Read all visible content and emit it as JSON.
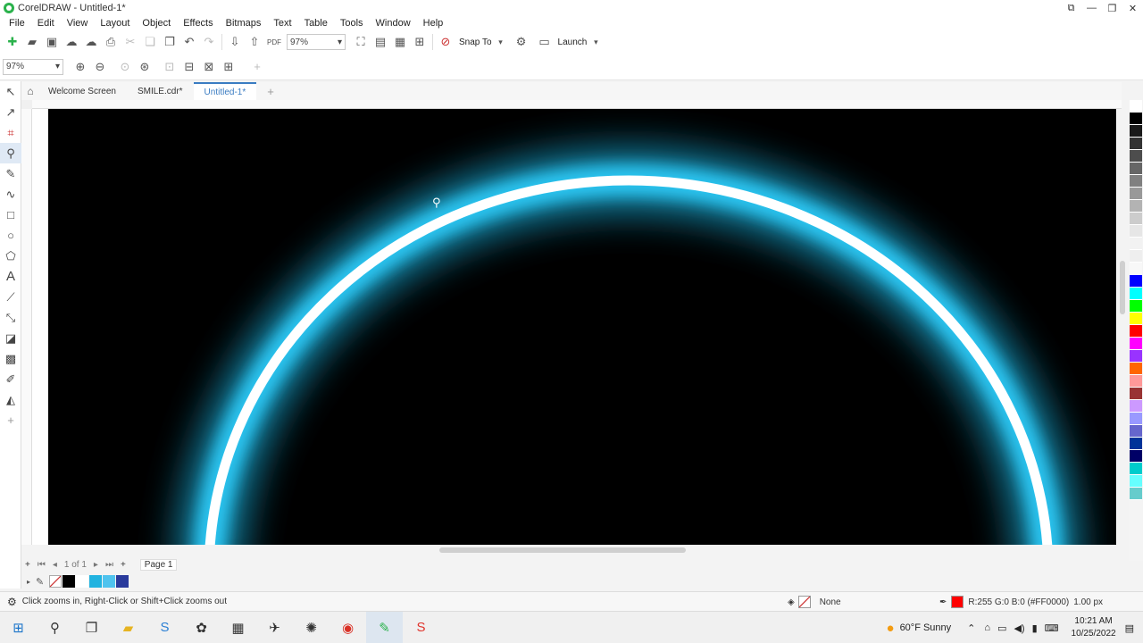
{
  "window": {
    "title": "CorelDRAW - Untitled-1*"
  },
  "menu": [
    "File",
    "Edit",
    "View",
    "Layout",
    "Object",
    "Effects",
    "Bitmaps",
    "Text",
    "Table",
    "Tools",
    "Window",
    "Help"
  ],
  "toolbar": {
    "zoom_value": "97%",
    "snap_to_label": "Snap To",
    "launch_label": "Launch"
  },
  "zoombar": {
    "zoom_value": "97%"
  },
  "tabs": [
    {
      "label": "Welcome Screen",
      "active": false
    },
    {
      "label": "SMILE.cdr*",
      "active": false
    },
    {
      "label": "Untitled-1*",
      "active": true
    }
  ],
  "pages": {
    "counter": "1 of 1",
    "page_tab": "Page 1"
  },
  "status": {
    "hint": "Click zooms in, Right-Click or Shift+Click zooms out",
    "fill_label": "None",
    "outline_color_text": "R:255 G:0 B:0 (#FF0000)",
    "outline_width": "1.00 px",
    "outline_color": "#FF0000"
  },
  "artwork": {
    "background": "#000000",
    "arc_stroke": "#FFFFFF",
    "glow_color": "#1FB8E6"
  },
  "palette_colors": [
    "#ffffff",
    "#000000",
    "#1a1a1a",
    "#333333",
    "#4d4d4d",
    "#666666",
    "#808080",
    "#999999",
    "#b3b3b3",
    "#cccccc",
    "#e6e6e6",
    "#f2f2f2",
    "#eeeeee",
    "#f8f8f8",
    "#0000ff",
    "#00ffff",
    "#00ff00",
    "#ffff00",
    "#ff0000",
    "#ff00ff",
    "#9933ff",
    "#ff6600",
    "#ff9999",
    "#993333",
    "#cc99ff",
    "#9999ff",
    "#6666cc",
    "#003399",
    "#000066",
    "#00cccc",
    "#66ffff",
    "#66cccc"
  ],
  "doc_palette_colors": [
    "#000000",
    "#ffffff",
    "#21b3e0",
    "#4fc3ee",
    "#2a3b9c"
  ],
  "taskbar": {
    "weather": "60°F  Sunny",
    "time": "10:21 AM",
    "date": "10/25/2022"
  }
}
